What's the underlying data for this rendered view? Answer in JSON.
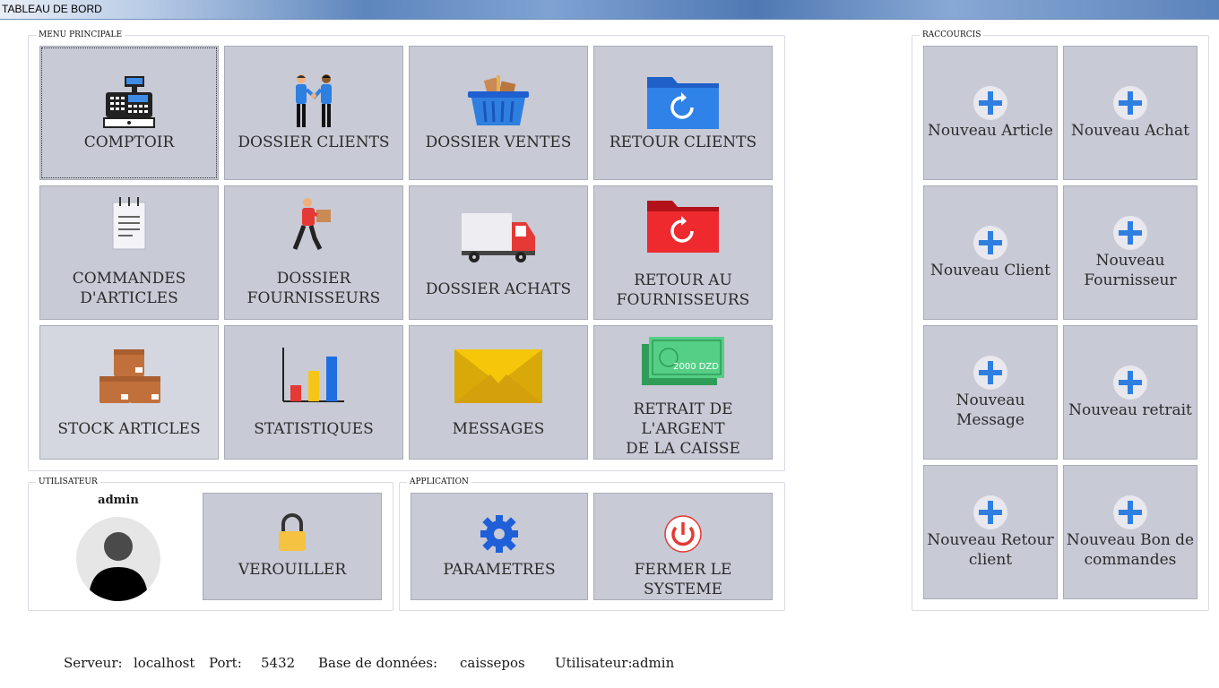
{
  "window": {
    "title": "TABLEAU DE BORD"
  },
  "groups": {
    "menu": "MENU PRINCIPALE",
    "user": "UTILISATEUR",
    "app": "APPLICATION",
    "shortcuts": "RACCOURCIS"
  },
  "menu": {
    "comptoir": "COMPTOIR",
    "dossier_clients": "DOSSIER CLIENTS",
    "dossier_ventes": "DOSSIER VENTES",
    "retour_clients": "RETOUR CLIENTS",
    "commandes_1": "COMMANDES",
    "commandes_2": "D'ARTICLES",
    "fournisseurs_1": "DOSSIER",
    "fournisseurs_2": "FOURNISSEURS",
    "dossier_achats": "DOSSIER ACHATS",
    "retour_fourn_1": "RETOUR AU",
    "retour_fourn_2": "FOURNISSEURS",
    "stock": "STOCK ARTICLES",
    "statistiques": "STATISTIQUES",
    "messages": "MESSAGES",
    "retrait_1": "RETRAIT DE L'ARGENT",
    "retrait_2": "DE LA CAISSE",
    "bill_text": "2000 DZD"
  },
  "user": {
    "name": "admin",
    "lock": "VEROUILLER"
  },
  "app": {
    "params": "PARAMETRES",
    "shutdown": "FERMER LE SYSTEME"
  },
  "shortcuts": {
    "nouveau_article": "Nouveau Article",
    "nouveau_achat": "Nouveau Achat",
    "nouveau_client": "Nouveau Client",
    "nouveau_fournisseur_1": "Nouveau",
    "nouveau_fournisseur_2": "Fournisseur",
    "nouveau_message": "Nouveau Message",
    "nouveau_retrait": "Nouveau retrait",
    "nouveau_retour_1": "Nouveau Retour",
    "nouveau_retour_2": "client",
    "nouveau_bon_1": "Nouveau Bon de",
    "nouveau_bon_2": "commandes"
  },
  "status": {
    "server_label": "Serveur:",
    "server": "localhost",
    "port_label": "Port:",
    "port": "5432",
    "db_label": "Base de données:",
    "db": "caissepos",
    "user_label": "Utilisateur:",
    "user": "admin"
  },
  "colors": {
    "tile": "#c8cad6",
    "accent_blue": "#2f7fe0",
    "status_value": "#1f2fb8"
  }
}
